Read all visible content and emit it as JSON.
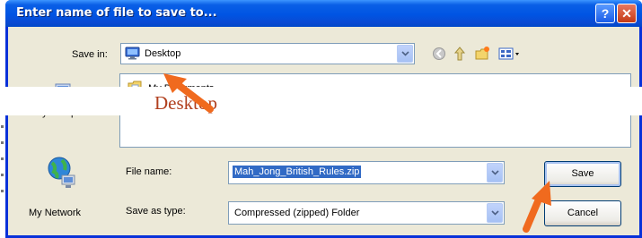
{
  "dialog": {
    "title": "Enter name of file to save to...",
    "help_glyph": "?",
    "close_glyph": "✕"
  },
  "save_in": {
    "label": "Save in:",
    "value": "Desktop",
    "icon": "desktop-icon"
  },
  "toolbar": {
    "icons": [
      "back-icon",
      "up-folder-icon",
      "new-folder-icon",
      "views-menu-icon"
    ]
  },
  "places": [
    {
      "label": "My Computer",
      "icon": "computer-icon"
    },
    {
      "label": "My Network",
      "icon": "network-globe-icon"
    }
  ],
  "file_list": {
    "items": [
      {
        "label": "My Documents",
        "icon": "documents-folder-icon"
      }
    ]
  },
  "annotation": {
    "text": "Desktop",
    "color": "#b1401f"
  },
  "file_name": {
    "label": "File name:",
    "value": "Mah_Jong_British_Rules.zip"
  },
  "save_as_type": {
    "label": "Save as type:",
    "value": "Compressed (zipped) Folder"
  },
  "buttons": {
    "save": "Save",
    "cancel": "Cancel"
  },
  "colors": {
    "titlebar": "#0054e3",
    "dialog_bg": "#ece9d8",
    "selection": "#316ac5",
    "arrow": "#f06a1e"
  }
}
